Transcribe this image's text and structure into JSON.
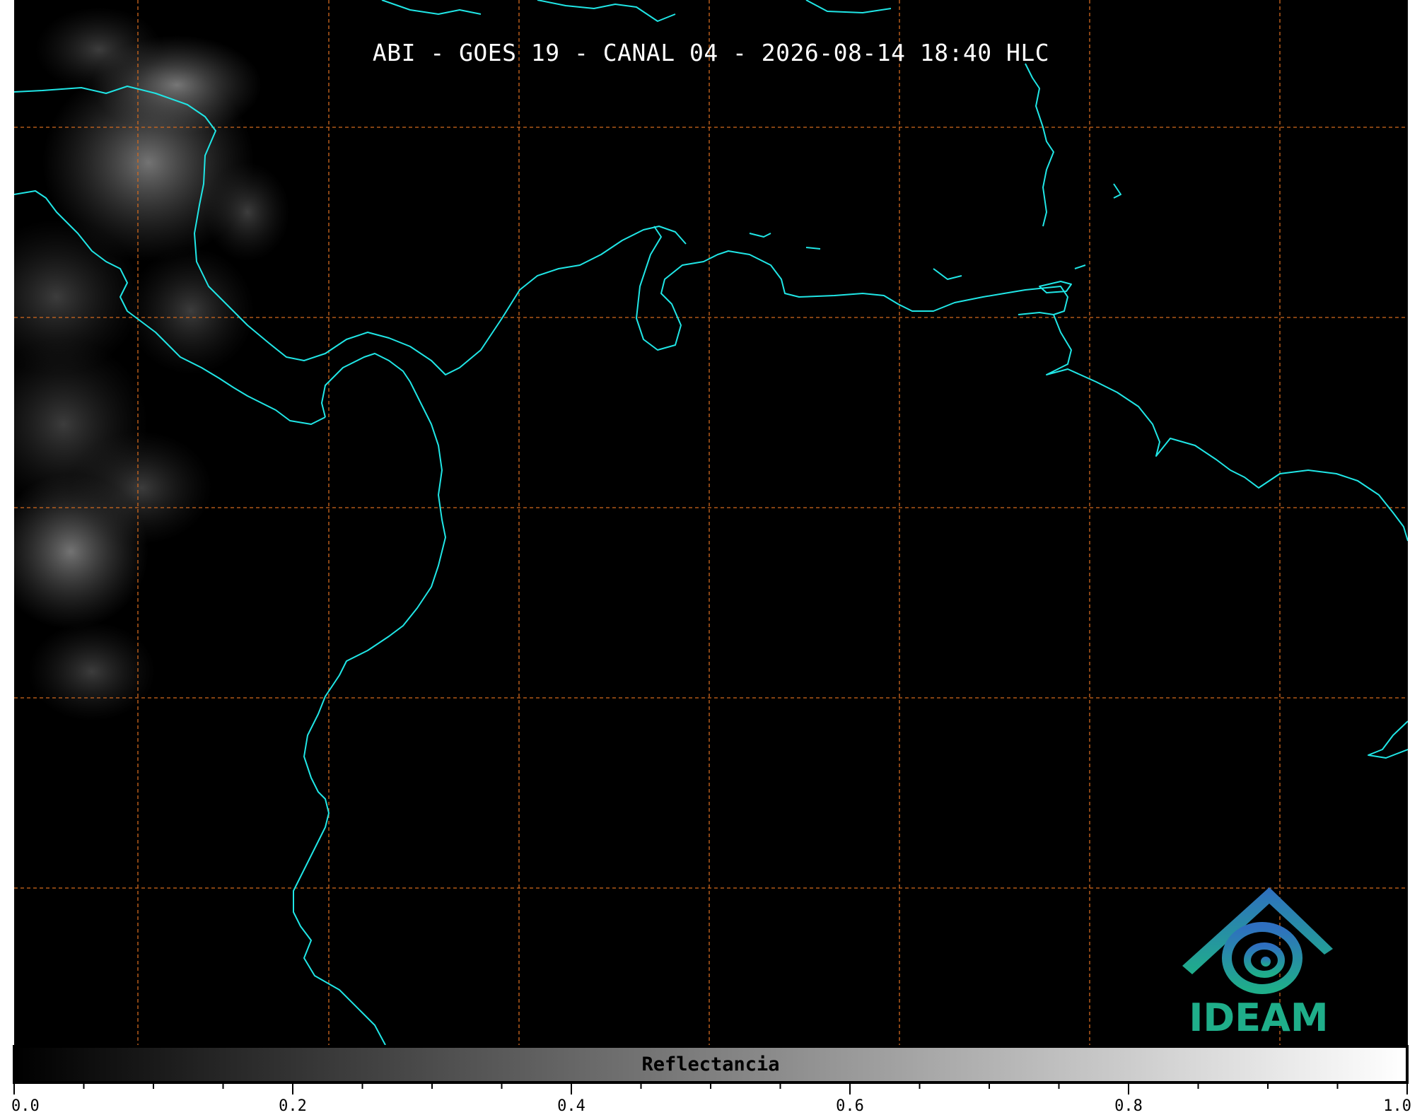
{
  "title": "ABI - GOES 19 - CANAL 04 - 2026-08-14 18:40 HLC",
  "logo": {
    "name": "ideam-logo",
    "text": "IDEAM"
  },
  "colorbar": {
    "label": "Reflectancia",
    "range": [
      0.0,
      1.0
    ],
    "tick_labels": [
      "0.0",
      "0.2",
      "0.4",
      "0.6",
      "0.8",
      "1.0"
    ],
    "minor_tick_step": 0.05,
    "colormap": [
      "#000000",
      "#ffffff"
    ]
  },
  "map_layers": {
    "background_color": "#000000",
    "coastline_color": "#20e6e6",
    "graticule_color": "#d2691e",
    "graticule_style": "dashed"
  }
}
